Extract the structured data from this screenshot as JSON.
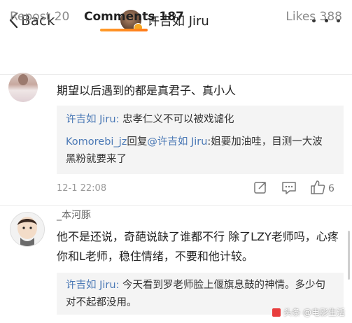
{
  "header": {
    "back_label": "Back",
    "title": "许吉如 Jiru"
  },
  "tabs": {
    "repost": "Repost 20",
    "comments": "Comments 187",
    "likes": "Likes 388"
  },
  "comments": [
    {
      "text": "期望以后遇到的都是真君子、真小人",
      "replies": [
        {
          "author": "许吉如 Jiru:",
          "text": " 忠孝仁义不可以被戏谑化"
        },
        {
          "author": "Komorebi_jz",
          "mid": "回复",
          "mention": "@许吉如 Jiru",
          "text": ":姐要加油哇，目测一大波黑粉就要来了"
        }
      ],
      "time": "12-1 22:08",
      "likes": "6"
    },
    {
      "username": "_本河豚",
      "text": "他不是还说，奇葩说缺了谁都不行 除了LZY老师吗，心疼你和L老师，稳住情绪，不要和他计较。",
      "replies": [
        {
          "author": "许吉如 Jiru:",
          "text": " 今天看到罗老师脸上偃旗息鼓的神情。多少句对不起都没用。"
        }
      ]
    }
  ],
  "watermark": "头条 @电影生活"
}
